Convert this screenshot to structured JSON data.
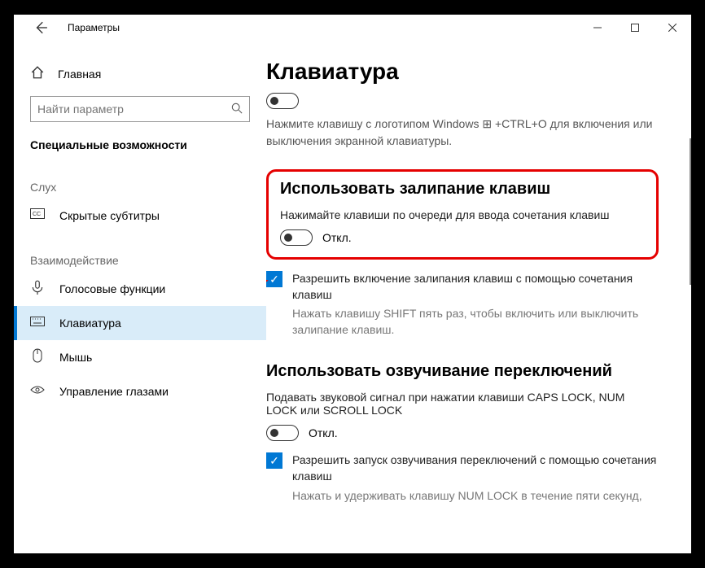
{
  "titlebar": {
    "title": "Параметры"
  },
  "sidebar": {
    "home": "Главная",
    "search_placeholder": "Найти параметр",
    "section": "Специальные возможности",
    "group_hearing": "Слух",
    "group_interaction": "Взаимодействие",
    "items": {
      "captions": "Скрытые субтитры",
      "speech": "Голосовые функции",
      "keyboard": "Клавиатура",
      "mouse": "Мышь",
      "eye": "Управление глазами"
    }
  },
  "content": {
    "title": "Клавиатура",
    "osk_hint": "Нажмите клавишу с логотипом Windows ⊞ +CTRL+O для включения или выключения экранной клавиатуры.",
    "sticky": {
      "heading": "Использовать залипание клавиш",
      "desc": "Нажимайте клавиши по очереди для ввода сочетания клавиш",
      "state": "Откл.",
      "allow_label": "Разрешить включение залипания клавиш с помощью сочетания клавиш",
      "allow_hint": "Нажать клавишу SHIFT пять раз, чтобы включить или выключить залипание клавиш."
    },
    "toggle_keys": {
      "heading": "Использовать озвучивание переключений",
      "desc": "Подавать звуковой сигнал при нажатии клавиши CAPS LOCK, NUM LOCK или SCROLL LOCK",
      "state": "Откл.",
      "allow_label": "Разрешить запуск озвучивания переключений с помощью сочетания клавиш",
      "allow_hint": "Нажать и удерживать клавишу NUM LOCK в течение пяти секунд,"
    }
  }
}
